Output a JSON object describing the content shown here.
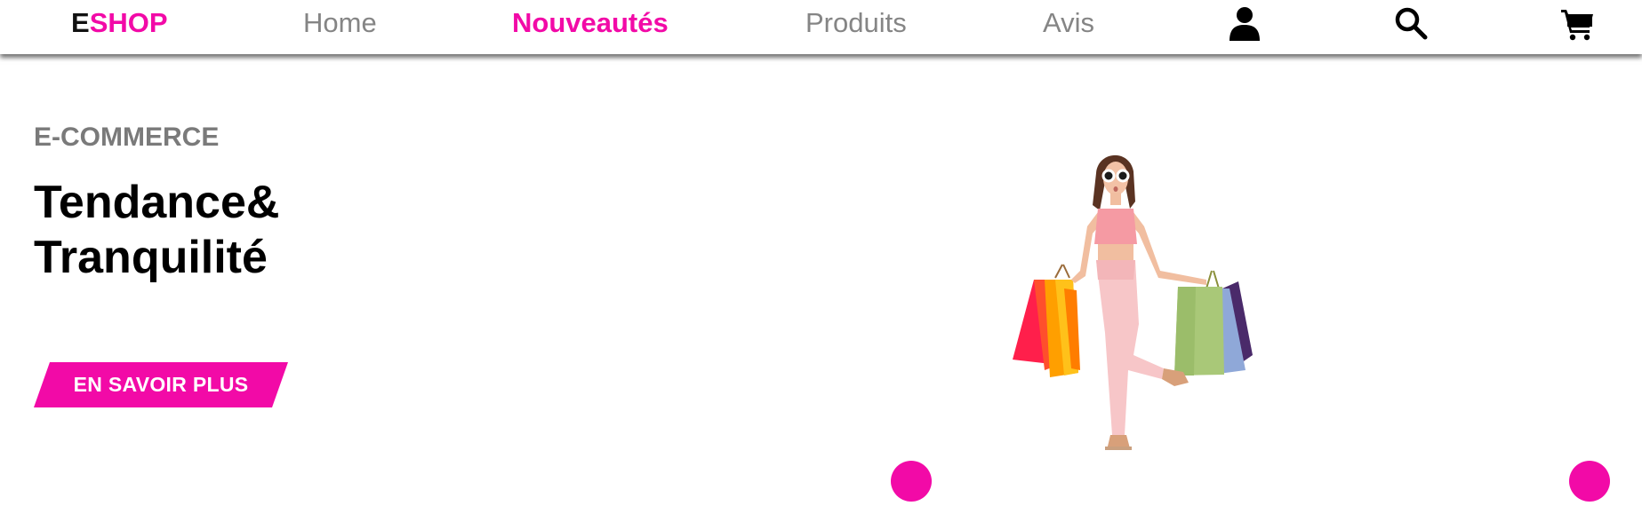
{
  "brand": {
    "first_letter": "E",
    "rest": "SHOP",
    "accent_color": "#f20aa7"
  },
  "nav": {
    "links": [
      {
        "label": "Home",
        "active": false
      },
      {
        "label": "Nouveautés",
        "active": true
      },
      {
        "label": "Produits",
        "active": false
      },
      {
        "label": "Avis",
        "active": false
      }
    ],
    "icons": [
      "user-icon",
      "search-icon",
      "cart-icon"
    ]
  },
  "hero": {
    "kicker": "E-COMMERCE",
    "title_line1": "Tendance&",
    "title_line2": "Tranquilité",
    "cta_label": "EN SAVOIR PLUS",
    "image": "woman-with-shopping-bags"
  },
  "carousel": {
    "controls": [
      "prev-dot",
      "next-dot"
    ],
    "color": "#f20aa7"
  }
}
